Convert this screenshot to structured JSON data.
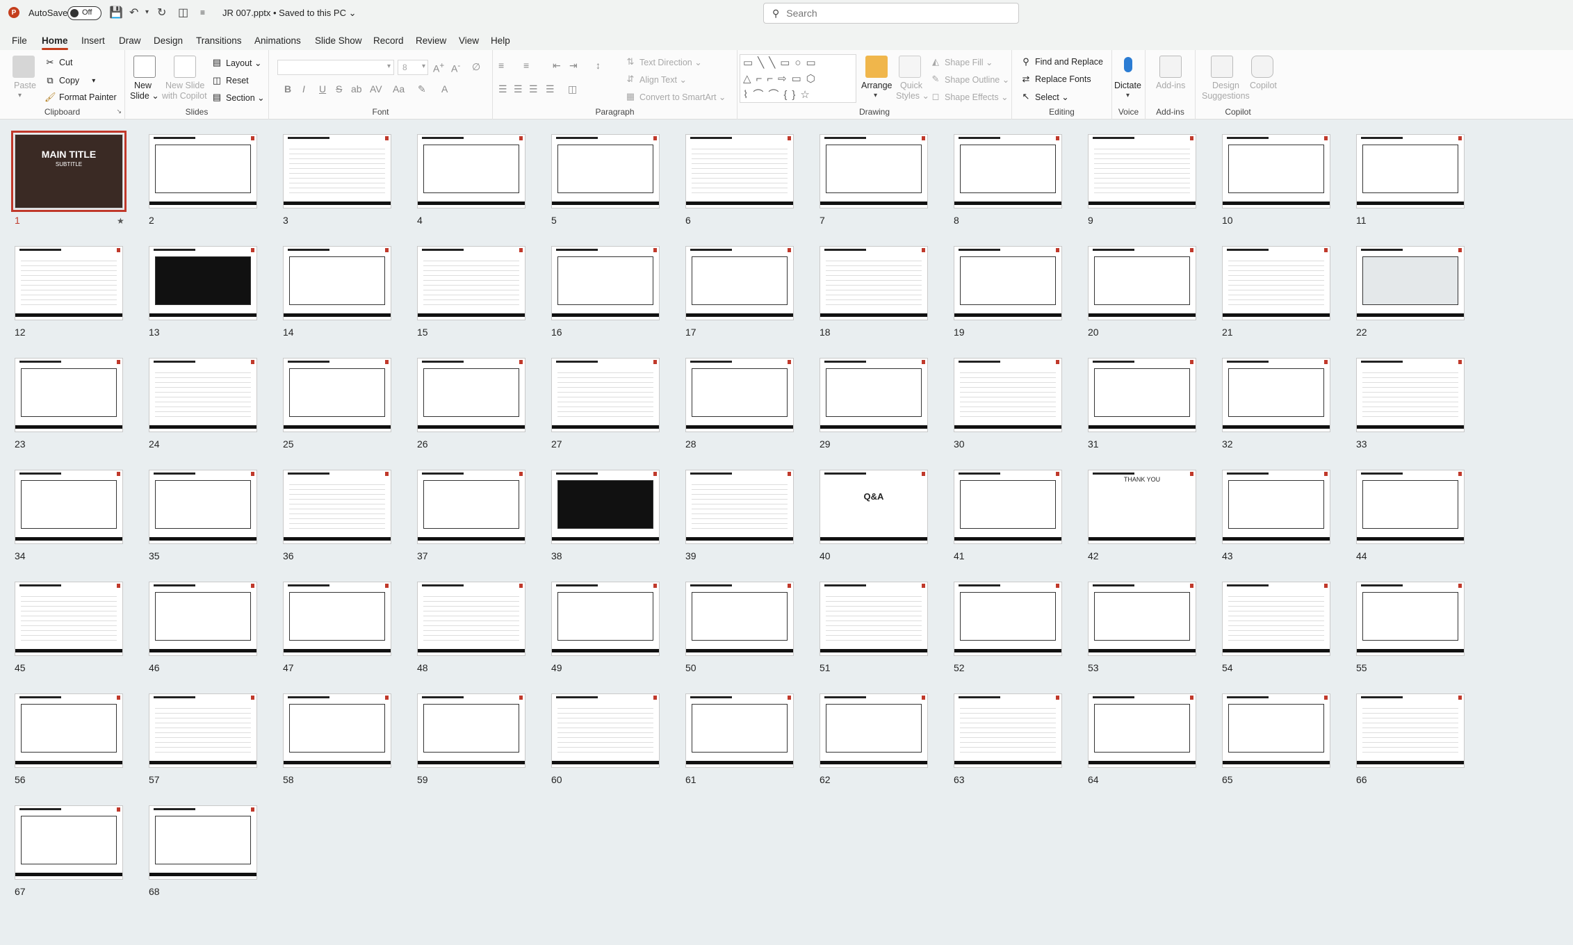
{
  "titlebar": {
    "app_icon": "powerpoint-icon",
    "autosave_label": "AutoSave",
    "autosave_state": "Off",
    "doc_title": "JR 007.pptx • Saved to this PC ⌄",
    "search_placeholder": "Search"
  },
  "menu": {
    "tabs": [
      "File",
      "Home",
      "Insert",
      "Draw",
      "Design",
      "Transitions",
      "Animations",
      "Slide Show",
      "Record",
      "Review",
      "View",
      "Help"
    ],
    "active": "Home"
  },
  "ribbon": {
    "clipboard": {
      "paste": "Paste",
      "cut": "Cut",
      "copy": "Copy",
      "format_painter": "Format Painter",
      "label": "Clipboard"
    },
    "slides": {
      "new_slide": "New",
      "new_slide2": "Slide ⌄",
      "new_slide_with_copilot": "New Slide",
      "new_slide_with_copilot2": "with Copilot",
      "layout": "Layout ⌄",
      "reset": "Reset",
      "section": "Section ⌄",
      "label": "Slides"
    },
    "font": {
      "label": "Font",
      "size": "8"
    },
    "paragraph": {
      "text_direction": "Text Direction ⌄",
      "align_text": "Align Text ⌄",
      "convert_smartart": "Convert to SmartArt ⌄",
      "label": "Paragraph"
    },
    "drawing": {
      "arrange": "Arrange",
      "quick_styles": "Quick",
      "quick_styles2": "Styles ⌄",
      "shape_fill": "Shape Fill ⌄",
      "shape_outline": "Shape Outline ⌄",
      "shape_effects": "Shape Effects ⌄",
      "label": "Drawing"
    },
    "editing": {
      "find_replace": "Find and Replace",
      "replace_fonts": "Replace Fonts",
      "select": "Select ⌄",
      "label": "Editing"
    },
    "voice": {
      "dictate": "Dictate",
      "label": "Voice"
    },
    "addins": {
      "addins": "Add-ins",
      "label": "Add-ins"
    },
    "copilot": {
      "design_suggestions": "Design",
      "design_suggestions2": "Suggestions",
      "copilot": "Copilot",
      "label": "Copilot"
    }
  },
  "slides": {
    "count": 68,
    "selected": 1,
    "first_slide_title": "MAIN TITLE",
    "first_slide_subtitle": "SUBTITLE",
    "slide_40_text": "Q&A",
    "slide_42_text": "THANK YOU"
  }
}
